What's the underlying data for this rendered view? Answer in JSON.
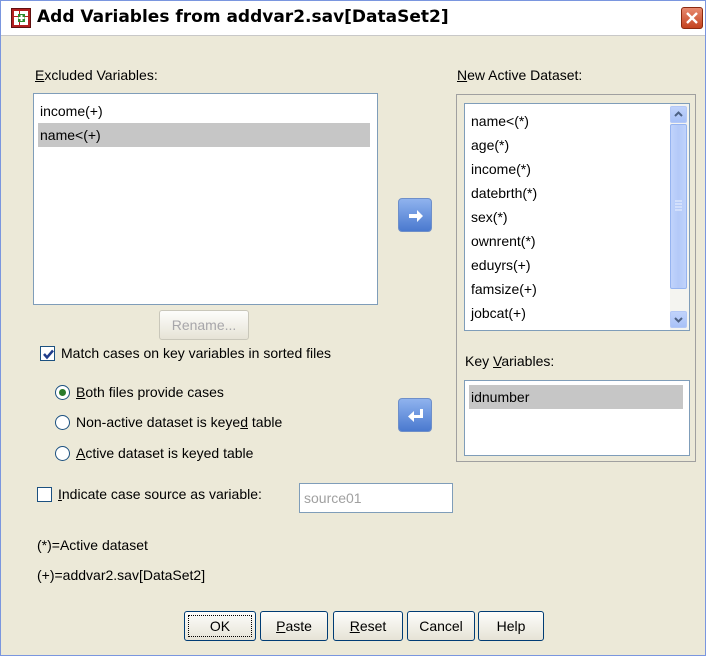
{
  "window": {
    "title": "Add Variables from addvar2.sav[DataSet2]",
    "icon": "spss-dialog-icon"
  },
  "excluded": {
    "label": "Excluded Variables:",
    "items": [
      "income(+)",
      "name<(+)"
    ]
  },
  "rename_label": "Rename...",
  "new_active": {
    "label": "New Active Dataset:",
    "items": [
      "name<(*)",
      "age(*)",
      "income(*)",
      "datebrth(*)",
      "sex(*)",
      "ownrent(*)",
      "eduyrs(+)",
      "famsize(+)",
      "jobcat(+)"
    ]
  },
  "key_variables": {
    "label": "Key Variables:",
    "items": [
      "idnumber"
    ]
  },
  "match_cases": {
    "label": "Match cases on key variables in sorted files",
    "checked": true
  },
  "radios": [
    {
      "label": "Both files provide cases",
      "selected": true
    },
    {
      "label": "Non-active dataset is keyed table",
      "selected": false
    },
    {
      "label": "Active dataset is keyed table",
      "selected": false
    }
  ],
  "indicate_source": {
    "label": "Indicate case source as variable:",
    "checked": false,
    "value": "source01"
  },
  "legend": {
    "active": "(*)=Active dataset",
    "other": "(+)=addvar2.sav[DataSet2]"
  },
  "buttons": {
    "ok": "OK",
    "paste": "Paste",
    "reset": "Reset",
    "cancel": "Cancel",
    "help": "Help"
  },
  "colors": {
    "selection": "#c6c6c6",
    "accent": "#4a79cf",
    "dialog_bg": "#ece9d8"
  }
}
